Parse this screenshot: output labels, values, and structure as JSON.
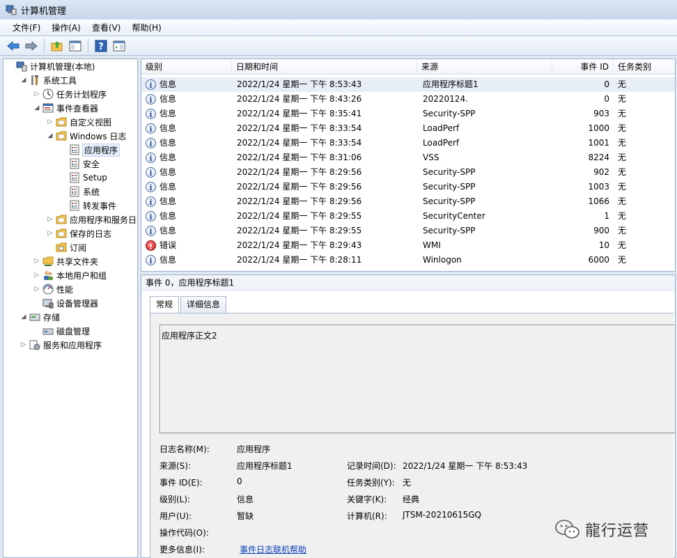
{
  "window": {
    "title": "计算机管理"
  },
  "menu": [
    "文件(F)",
    "操作(A)",
    "查看(V)",
    "帮助(H)"
  ],
  "toolbar": {
    "icons": [
      "back-arrow-icon",
      "forward-arrow-icon",
      "up-folder-icon",
      "show-hide-tree-icon",
      "help-icon",
      "action-pane-icon"
    ]
  },
  "tree": [
    {
      "label": "计算机管理(本地)",
      "icon": "computer-management-icon",
      "arrow": "",
      "depth": 0
    },
    {
      "label": "系统工具",
      "icon": "tools-icon",
      "arrow": "expanded",
      "depth": 1
    },
    {
      "label": "任务计划程序",
      "icon": "clock-icon",
      "arrow": "collapsed",
      "depth": 2
    },
    {
      "label": "事件查看器",
      "icon": "event-viewer-icon",
      "arrow": "expanded",
      "depth": 2
    },
    {
      "label": "自定义视图",
      "icon": "folder-icon",
      "arrow": "collapsed",
      "depth": 3
    },
    {
      "label": "Windows 日志",
      "icon": "folder-icon",
      "arrow": "expanded",
      "depth": 3
    },
    {
      "label": "应用程序",
      "icon": "log-icon",
      "arrow": "",
      "depth": 4,
      "selected": true
    },
    {
      "label": "安全",
      "icon": "log-icon",
      "arrow": "",
      "depth": 4
    },
    {
      "label": "Setup",
      "icon": "log-icon",
      "arrow": "",
      "depth": 4
    },
    {
      "label": "系统",
      "icon": "log-icon",
      "arrow": "",
      "depth": 4
    },
    {
      "label": "转发事件",
      "icon": "log-icon",
      "arrow": "",
      "depth": 4
    },
    {
      "label": "应用程序和服务日志",
      "icon": "folder-icon",
      "arrow": "collapsed",
      "depth": 3
    },
    {
      "label": "保存的日志",
      "icon": "folder-icon",
      "arrow": "collapsed",
      "depth": 3
    },
    {
      "label": "订阅",
      "icon": "subscription-icon",
      "arrow": "",
      "depth": 3
    },
    {
      "label": "共享文件夹",
      "icon": "shared-folder-icon",
      "arrow": "collapsed",
      "depth": 2
    },
    {
      "label": "本地用户和组",
      "icon": "users-icon",
      "arrow": "collapsed",
      "depth": 2
    },
    {
      "label": "性能",
      "icon": "performance-icon",
      "arrow": "collapsed",
      "depth": 2
    },
    {
      "label": "设备管理器",
      "icon": "device-manager-icon",
      "arrow": "",
      "depth": 2
    },
    {
      "label": "存储",
      "icon": "storage-icon",
      "arrow": "expanded",
      "depth": 1
    },
    {
      "label": "磁盘管理",
      "icon": "disk-icon",
      "arrow": "",
      "depth": 2
    },
    {
      "label": "服务和应用程序",
      "icon": "services-icon",
      "arrow": "collapsed",
      "depth": 1
    }
  ],
  "events": {
    "columns": [
      "级别",
      "日期和时间",
      "来源",
      "事件 ID",
      "任务类别"
    ],
    "rows": [
      {
        "level": "信息",
        "type": "info",
        "datetime": "2022/1/24 星期一 下午 8:53:43",
        "source": "应用程序标题1",
        "id": "0",
        "category": "无"
      },
      {
        "level": "信息",
        "type": "info",
        "datetime": "2022/1/24 星期一 下午 8:43:26",
        "source": "20220124.",
        "id": "0",
        "category": "无"
      },
      {
        "level": "信息",
        "type": "info",
        "datetime": "2022/1/24 星期一 下午 8:35:41",
        "source": "Security-SPP",
        "id": "903",
        "category": "无"
      },
      {
        "level": "信息",
        "type": "info",
        "datetime": "2022/1/24 星期一 下午 8:33:54",
        "source": "LoadPerf",
        "id": "1000",
        "category": "无"
      },
      {
        "level": "信息",
        "type": "info",
        "datetime": "2022/1/24 星期一 下午 8:33:54",
        "source": "LoadPerf",
        "id": "1001",
        "category": "无"
      },
      {
        "level": "信息",
        "type": "info",
        "datetime": "2022/1/24 星期一 下午 8:31:06",
        "source": "VSS",
        "id": "8224",
        "category": "无"
      },
      {
        "level": "信息",
        "type": "info",
        "datetime": "2022/1/24 星期一 下午 8:29:56",
        "source": "Security-SPP",
        "id": "902",
        "category": "无"
      },
      {
        "level": "信息",
        "type": "info",
        "datetime": "2022/1/24 星期一 下午 8:29:56",
        "source": "Security-SPP",
        "id": "1003",
        "category": "无"
      },
      {
        "level": "信息",
        "type": "info",
        "datetime": "2022/1/24 星期一 下午 8:29:56",
        "source": "Security-SPP",
        "id": "1066",
        "category": "无"
      },
      {
        "level": "信息",
        "type": "info",
        "datetime": "2022/1/24 星期一 下午 8:29:55",
        "source": "SecurityCenter",
        "id": "1",
        "category": "无"
      },
      {
        "level": "信息",
        "type": "info",
        "datetime": "2022/1/24 星期一 下午 8:29:55",
        "source": "Security-SPP",
        "id": "900",
        "category": "无"
      },
      {
        "level": "错误",
        "type": "error",
        "datetime": "2022/1/24 星期一 下午 8:29:43",
        "source": "WMI",
        "id": "10",
        "category": "无"
      },
      {
        "level": "信息",
        "type": "info",
        "datetime": "2022/1/24 星期一 下午 8:28:11",
        "source": "Winlogon",
        "id": "6000",
        "category": "无"
      }
    ]
  },
  "detail": {
    "header": "事件 0，应用程序标题1",
    "tabs": [
      "常规",
      "详细信息"
    ],
    "description": "应用程序正文2",
    "fields": {
      "log_name_label": "日志名称(M):",
      "log_name": "应用程序",
      "source_label": "来源(S):",
      "source": "应用程序标题1",
      "logged_label": "记录时间(D):",
      "logged": "2022/1/24 星期一 下午 8:53:43",
      "event_id_label": "事件 ID(E):",
      "event_id": "0",
      "task_label": "任务类别(Y):",
      "task": "无",
      "level_label": "级别(L):",
      "level": "信息",
      "keywords_label": "关键字(K):",
      "keywords": "经典",
      "user_label": "用户(U):",
      "user": "暂缺",
      "computer_label": "计算机(R):",
      "computer": "JTSM-20210615GQ",
      "opcode_label": "操作代码(O):",
      "more_info_label": "更多信息(I):",
      "more_info_link": "事件日志联机帮助"
    }
  },
  "watermark": {
    "text": "龍行运营"
  }
}
